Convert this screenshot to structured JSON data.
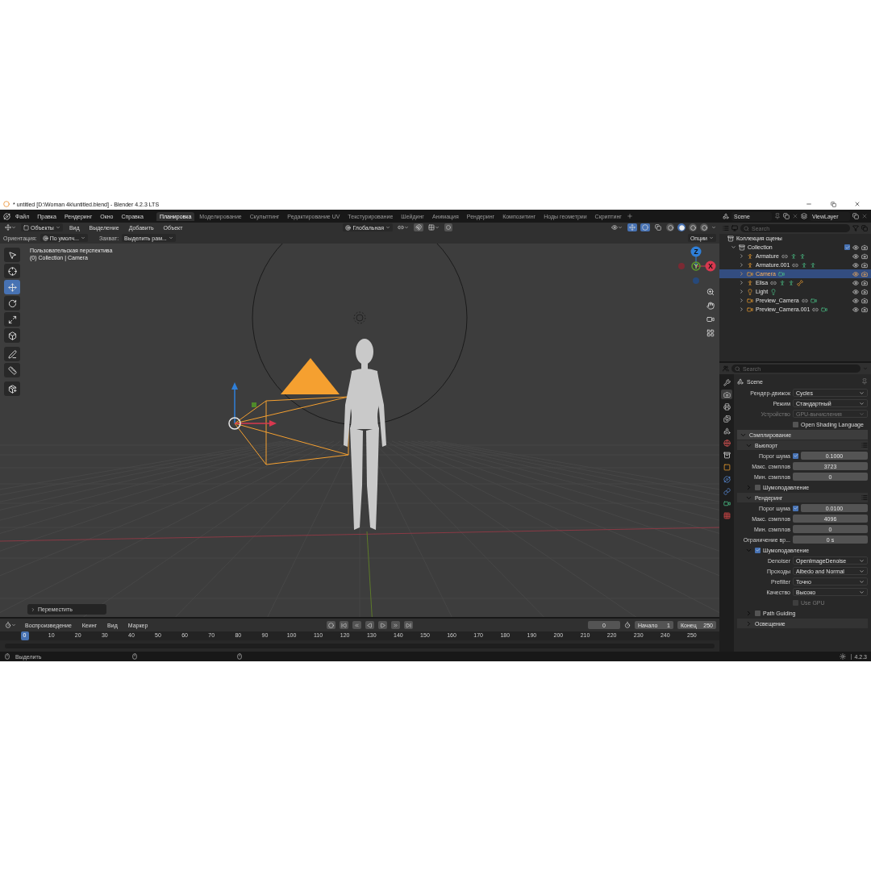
{
  "window": {
    "title": "* untitled [D:\\Woman 4k\\untitled.blend] - Blender 4.2.3 LTS"
  },
  "menu": [
    "Файл",
    "Правка",
    "Рендеринг",
    "Окно",
    "Справка"
  ],
  "workspaces": [
    {
      "label": "Планировка",
      "selected": true
    },
    {
      "label": "Моделирование",
      "selected": false
    },
    {
      "label": "Скульптинг",
      "selected": false
    },
    {
      "label": "Редактирование UV",
      "selected": false
    },
    {
      "label": "Текстурирование",
      "selected": false
    },
    {
      "label": "Шейдинг",
      "selected": false
    },
    {
      "label": "Анимация",
      "selected": false
    },
    {
      "label": "Рендеринг",
      "selected": false
    },
    {
      "label": "Композитинг",
      "selected": false
    },
    {
      "label": "Ноды геометрии",
      "selected": false
    },
    {
      "label": "Скриптинг",
      "selected": false
    }
  ],
  "scene_selector": {
    "scene": "Scene",
    "view_layer": "ViewLayer"
  },
  "viewport": {
    "mode": "Объекты",
    "menus": [
      "Вид",
      "Выделение",
      "Добавить",
      "Объект"
    ],
    "orientation": "Глобальная",
    "shading": [
      {
        "kind": "wireframe",
        "selected": false
      },
      {
        "kind": "solid",
        "selected": true
      },
      {
        "kind": "material",
        "selected": false
      },
      {
        "kind": "rendered",
        "selected": false
      }
    ],
    "tool_settings": {
      "orientation_label": "Ориентация:",
      "orientation_value": "По умолч...",
      "snap_label": "Захват:",
      "snap_value": "Выделить рам...",
      "options": "Опции"
    },
    "overlay": [
      "Пользовательская перспектива",
      "(0) Collection | Camera"
    ],
    "tools": [
      {
        "kind": "select",
        "selected": false
      },
      {
        "kind": "cursor",
        "selected": false
      },
      {
        "kind": "move",
        "selected": true
      },
      {
        "kind": "rotate",
        "selected": false
      },
      {
        "kind": "scale",
        "selected": false
      },
      {
        "kind": "transform",
        "selected": false
      },
      {
        "kind": "annotate",
        "selected": false
      },
      {
        "kind": "measure",
        "selected": false
      },
      {
        "kind": "add",
        "selected": false
      }
    ],
    "gizmo_axes": [
      "X",
      "Y",
      "Z"
    ],
    "last_operator": "Переместить"
  },
  "timeline": {
    "menus": [
      "Воспроизведение",
      "Кеинг",
      "Вид",
      "Маркер"
    ],
    "current_frame": "0",
    "start_label": "Начало",
    "start": "1",
    "end_label": "Конец",
    "end": "250",
    "ticks": [
      {
        "label": "0",
        "selected": true
      },
      {
        "label": "10",
        "selected": false
      },
      {
        "label": "20",
        "selected": false
      },
      {
        "label": "30",
        "selected": false
      },
      {
        "label": "40",
        "selected": false
      },
      {
        "label": "50",
        "selected": false
      },
      {
        "label": "60",
        "selected": false
      },
      {
        "label": "70",
        "selected": false
      },
      {
        "label": "80",
        "selected": false
      },
      {
        "label": "90",
        "selected": false
      },
      {
        "label": "100",
        "selected": false
      },
      {
        "label": "110",
        "selected": false
      },
      {
        "label": "120",
        "selected": false
      },
      {
        "label": "130",
        "selected": false
      },
      {
        "label": "140",
        "selected": false
      },
      {
        "label": "150",
        "selected": false
      },
      {
        "label": "160",
        "selected": false
      },
      {
        "label": "170",
        "selected": false
      },
      {
        "label": "180",
        "selected": false
      },
      {
        "label": "190",
        "selected": false
      },
      {
        "label": "200",
        "selected": false
      },
      {
        "label": "210",
        "selected": false
      },
      {
        "label": "220",
        "selected": false
      },
      {
        "label": "230",
        "selected": false
      },
      {
        "label": "240",
        "selected": false
      },
      {
        "label": "250",
        "selected": false
      }
    ]
  },
  "status_bar": {
    "hint": "Выделить",
    "version": "4.2.3"
  },
  "outliner": {
    "search_placeholder": "Search",
    "root": "Коллекция сцены",
    "tree": [
      {
        "name": "Collection",
        "kind": "collection",
        "expanded": true,
        "checked": true,
        "selected": false,
        "children": [
          {
            "name": "Armature",
            "kind": "armature",
            "expanded": false,
            "selected": false,
            "extras": [
              {
                "kind": "constraint"
              },
              {
                "kind": "pose"
              },
              {
                "kind": "pose"
              }
            ]
          },
          {
            "name": "Armature.001",
            "kind": "armature",
            "expanded": false,
            "selected": false,
            "extras": [
              {
                "kind": "constraint"
              },
              {
                "kind": "pose"
              },
              {
                "kind": "pose"
              }
            ]
          },
          {
            "name": "Camera",
            "kind": "camera",
            "expanded": false,
            "selected": true,
            "extras": [
              {
                "kind": "camera_data"
              }
            ]
          },
          {
            "name": "Elisa",
            "kind": "armature",
            "expanded": false,
            "selected": false,
            "extras": [
              {
                "kind": "constraint"
              },
              {
                "kind": "pose"
              },
              {
                "kind": "pose"
              },
              {
                "kind": "vertex_groups"
              }
            ]
          },
          {
            "name": "Light",
            "kind": "light",
            "expanded": false,
            "selected": false,
            "extras": [
              {
                "kind": "light_data"
              }
            ]
          },
          {
            "name": "Preview_Camera",
            "kind": "camera",
            "expanded": false,
            "selected": false,
            "extras": [
              {
                "kind": "constraint"
              },
              {
                "kind": "camera_data"
              }
            ]
          },
          {
            "name": "Preview_Camera.001",
            "kind": "camera",
            "expanded": false,
            "selected": false,
            "extras": [
              {
                "kind": "constraint"
              },
              {
                "kind": "camera_data"
              }
            ]
          }
        ]
      }
    ]
  },
  "properties": {
    "search_placeholder": "Search",
    "context": "Scene",
    "tabs": [
      {
        "kind": "tool",
        "selected": false
      },
      {
        "kind": "render",
        "selected": true
      },
      {
        "kind": "output",
        "selected": false
      },
      {
        "kind": "view_layer",
        "selected": false
      },
      {
        "kind": "scene",
        "selected": false
      },
      {
        "kind": "world",
        "selected": false
      },
      {
        "kind": "collection",
        "selected": false
      },
      {
        "kind": "object",
        "selected": false
      },
      {
        "kind": "physics",
        "selected": false
      },
      {
        "kind": "constraints",
        "selected": false
      },
      {
        "kind": "data",
        "selected": false
      },
      {
        "kind": "texture",
        "selected": false
      }
    ],
    "rows": [
      {
        "kind": "dropdown",
        "label": "Рендер-движок",
        "value": "Cycles",
        "disabled": false
      },
      {
        "kind": "dropdown",
        "label": "Режим",
        "value": "Стандартный",
        "disabled": false
      },
      {
        "kind": "dropdown",
        "label": "Устройство",
        "value": "GPU-вычисления",
        "disabled": true
      },
      {
        "kind": "checkbox",
        "label": "Open Shading Language",
        "checked": false,
        "disabled": false
      },
      {
        "kind": "panel",
        "label": "Сэмплирование",
        "expanded": true
      },
      {
        "kind": "subpanel",
        "label": "Вьюпорт",
        "expanded": true,
        "presets": true
      },
      {
        "kind": "toggle_number",
        "label": "Порог шума",
        "checked": true,
        "value": "0.1000"
      },
      {
        "kind": "number",
        "label": "Макс. сэмплов",
        "value": "3723"
      },
      {
        "kind": "number",
        "label": "Мин. сэмплов",
        "value": "0"
      },
      {
        "kind": "subpanel_check",
        "label": "Шумоподавление",
        "expanded": false,
        "checked": false
      },
      {
        "kind": "subpanel",
        "label": "Рендеринг",
        "expanded": true,
        "presets": true
      },
      {
        "kind": "toggle_number",
        "label": "Порог шума",
        "checked": true,
        "value": "0.0100"
      },
      {
        "kind": "number",
        "label": "Макс. сэмплов",
        "value": "4096"
      },
      {
        "kind": "number",
        "label": "Мин. сэмплов",
        "value": "0"
      },
      {
        "kind": "number",
        "label": "Ограничение вр...",
        "value": "0 s"
      },
      {
        "kind": "subpanel_check",
        "label": "Шумоподавление",
        "expanded": true,
        "checked": true
      },
      {
        "kind": "dropdown",
        "label": "Denoiser",
        "value": "OpenImageDenoise",
        "disabled": false
      },
      {
        "kind": "dropdown",
        "label": "Проходы",
        "value": "Albedo and Normal",
        "disabled": false
      },
      {
        "kind": "dropdown",
        "label": "Prefilter",
        "value": "Точно",
        "disabled": false
      },
      {
        "kind": "dropdown",
        "label": "Качество",
        "value": "Высоко",
        "disabled": false
      },
      {
        "kind": "checkbox",
        "label": "Use GPU",
        "checked": false,
        "disabled": true
      },
      {
        "kind": "subpanel_check",
        "label": "Path Guiding",
        "expanded": false,
        "checked": false
      },
      {
        "kind": "subpanel",
        "label": "Освещение",
        "expanded": false,
        "presets": false
      }
    ]
  }
}
